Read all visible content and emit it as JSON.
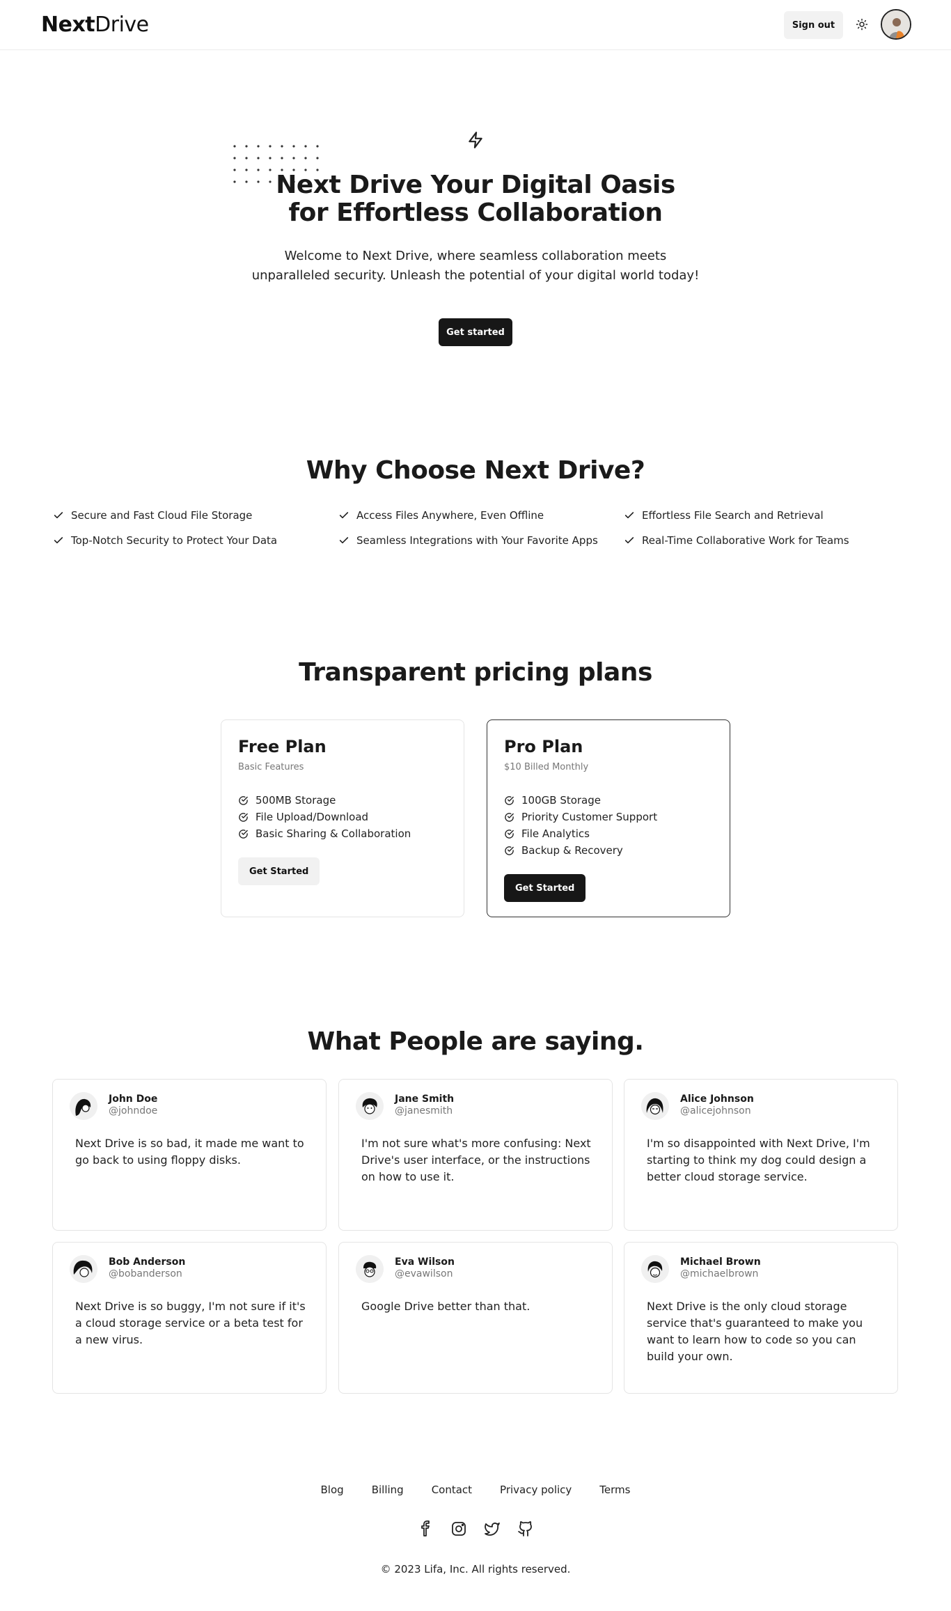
{
  "header": {
    "logo_bold": "Next",
    "logo_regular": "Drive",
    "signout_label": "Sign out",
    "theme_icon": "sun-icon",
    "avatar_icon": "user-avatar"
  },
  "hero": {
    "icon": "lightning-icon",
    "title_line1": "Next Drive Your Digital Oasis",
    "title_line2": "for Effortless Collaboration",
    "subtitle": "Welcome to Next Drive, where seamless collaboration meets unparalleled security. Unleash the potential of your digital world today!",
    "cta_label": "Get started"
  },
  "features": {
    "title": "Why Choose Next Drive?",
    "items": [
      "Secure and Fast Cloud File Storage",
      "Access Files Anywhere, Even Offline",
      "Effortless File Search and Retrieval",
      "Top-Notch Security to Protect Your Data",
      "Seamless Integrations with Your Favorite Apps",
      "Real-Time Collaborative Work for Teams"
    ]
  },
  "pricing": {
    "title": "Transparent pricing plans",
    "plans": [
      {
        "name": "Free Plan",
        "desc": "Basic Features",
        "features": [
          "500MB Storage",
          "File Upload/Download",
          "Basic Sharing & Collaboration"
        ],
        "cta": "Get Started"
      },
      {
        "name": "Pro Plan",
        "desc": "$10 Billed Monthly",
        "features": [
          "100GB Storage",
          "Priority Customer Support",
          "File Analytics",
          "Backup & Recovery"
        ],
        "cta": "Get Started"
      }
    ]
  },
  "testimonials": {
    "title": "What People are saying.",
    "items": [
      {
        "name": "John Doe",
        "handle": "@johndoe",
        "text": "Next Drive is so bad, it made me want to go back to using floppy disks."
      },
      {
        "name": "Jane Smith",
        "handle": "@janesmith",
        "text": "I'm not sure what's more confusing: Next Drive's user interface, or the instructions on how to use it."
      },
      {
        "name": "Alice Johnson",
        "handle": "@alicejohnson",
        "text": "I'm so disappointed with Next Drive, I'm starting to think my dog could design a better cloud storage service."
      },
      {
        "name": "Bob Anderson",
        "handle": "@bobanderson",
        "text": "Next Drive is so buggy, I'm not sure if it's a cloud storage service or a beta test for a new virus."
      },
      {
        "name": "Eva Wilson",
        "handle": "@evawilson",
        "text": "Google Drive better than that."
      },
      {
        "name": "Michael Brown",
        "handle": "@michaelbrown",
        "text": "Next Drive is the only cloud storage service that's guaranteed to make you want to learn how to code so you can build your own."
      }
    ]
  },
  "footer": {
    "links": [
      "Blog",
      "Billing",
      "Contact",
      "Privacy policy",
      "Terms"
    ],
    "social_icons": [
      "facebook-icon",
      "instagram-icon",
      "twitter-icon",
      "github-icon"
    ],
    "copyright": "© 2023 Lifa, Inc. All rights reserved."
  }
}
